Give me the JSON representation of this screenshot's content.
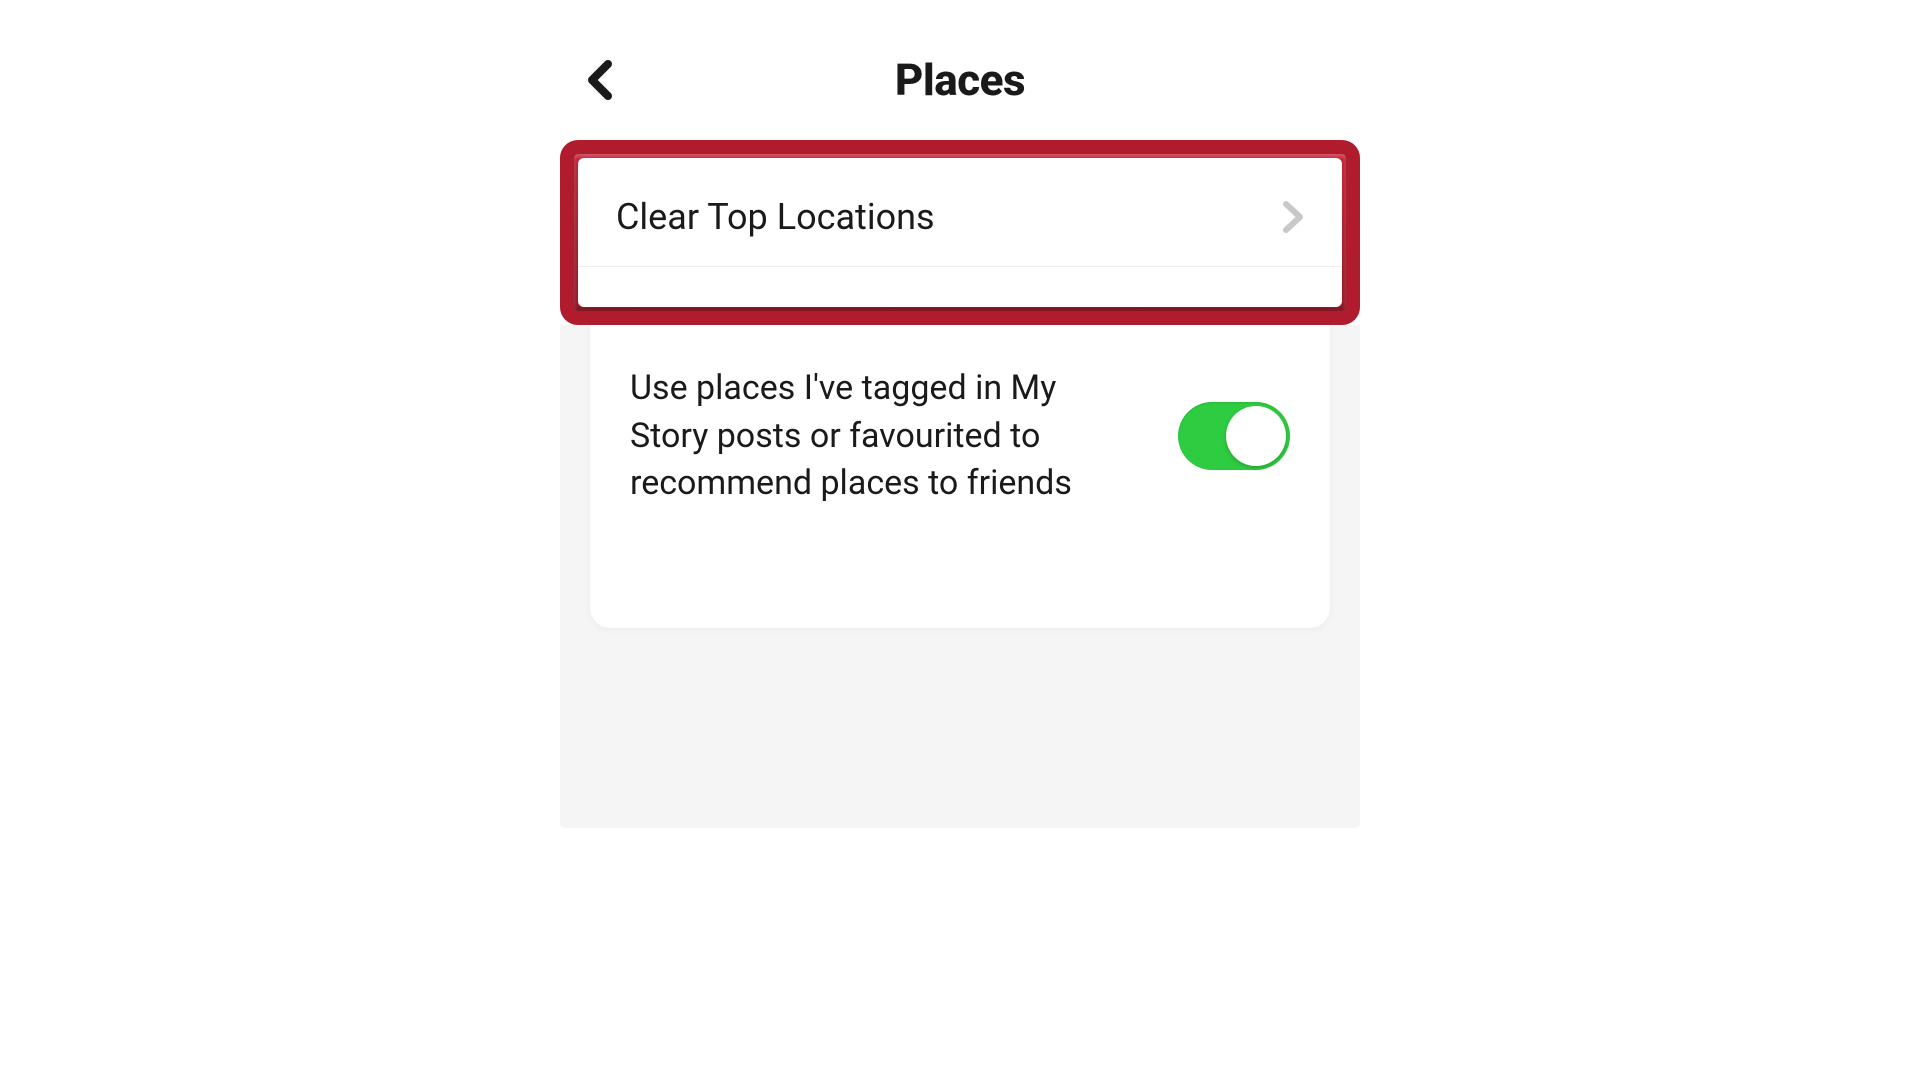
{
  "header": {
    "title": "Places"
  },
  "rows": {
    "clearTopLocations": {
      "label": "Clear Top Locations"
    },
    "recommendToggle": {
      "label": "Use places I've tagged in My Story posts or favourited to recommend places to friends",
      "enabled": true
    }
  },
  "colors": {
    "highlight": "#b01c2e",
    "toggleOn": "#2ecc40"
  }
}
